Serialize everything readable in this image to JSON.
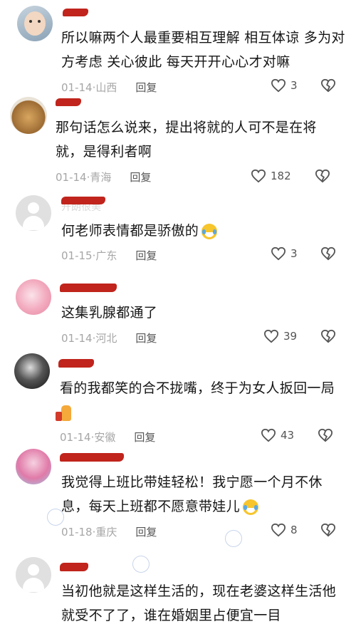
{
  "comments": [
    {
      "text": "所以嘛两个人最重要相互理解 相互体谅 多为对方考虑 关心彼此 每天开开心心才对嘛",
      "date": "01-14",
      "location": "山西",
      "reply": "回复",
      "likes": "3"
    },
    {
      "text": "那句话怎么说来，提出将就的人可不是在将就，是得利者啊",
      "date": "01-14",
      "location": "青海",
      "reply": "回复",
      "likes": "182"
    },
    {
      "text": "何老师表情都是骄傲的",
      "date": "01-15",
      "location": "广东",
      "reply": "回复",
      "likes": "3",
      "name_ghost": "开朗很美"
    },
    {
      "text": "这集乳腺都通了",
      "date": "01-14",
      "location": "河北",
      "reply": "回复",
      "likes": "39"
    },
    {
      "text": "看的我都笑的合不拢嘴，终于为女人扳回一局",
      "date": "01-14",
      "location": "安徽",
      "reply": "回复",
      "likes": "43"
    },
    {
      "text": "我觉得上班比带娃轻松！我宁愿一个月不休息，每天上班都不愿意带娃儿",
      "date": "01-18",
      "location": "重庆",
      "reply": "回复",
      "likes": "8"
    },
    {
      "text": "当初他就是这样生活的，现在老婆这样生活他就受不了了，谁在婚姻里占便宜一目"
    }
  ],
  "icons": {
    "like": "heart-outline-icon",
    "dislike": "broken-heart-icon",
    "emoji_laugh": "laughing-tears-emoji",
    "emoji_thumb": "thumbs-up-emoji"
  },
  "colors": {
    "redaction": "#c0241c",
    "meta": "#a6a6a6",
    "text": "#161616"
  }
}
